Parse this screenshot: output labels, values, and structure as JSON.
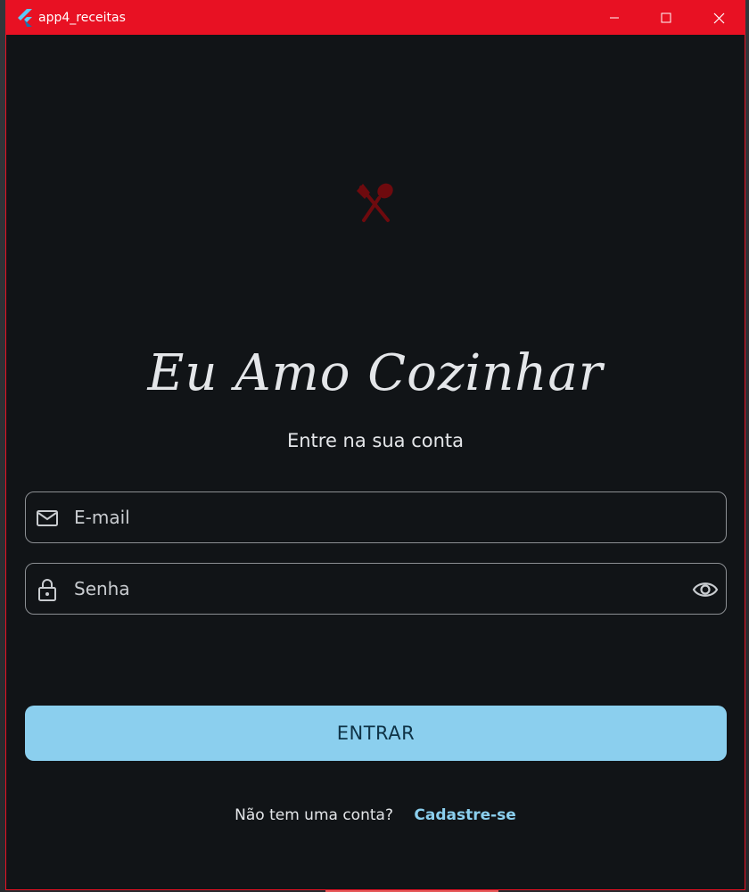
{
  "window": {
    "title": "app4_receitas",
    "titlebar_color": "#e81123"
  },
  "app": {
    "name": "Eu Amo Cozinhar",
    "subtitle": "Entre na sua conta",
    "logo_icon": "fork-spoon-icon",
    "logo_color": "#6e0a0e"
  },
  "form": {
    "email": {
      "placeholder": "E-mail",
      "value": "",
      "icon": "mail-icon"
    },
    "password": {
      "placeholder": "Senha",
      "value": "",
      "icon": "lock-icon",
      "toggle_icon": "eye-icon"
    },
    "submit_label": "ENTRAR"
  },
  "signup": {
    "prompt": "Não tem uma conta?",
    "link": "Cadastre-se"
  },
  "colors": {
    "background": "#111417",
    "accent": "#8bcfee",
    "text": "#e4e6e9"
  }
}
